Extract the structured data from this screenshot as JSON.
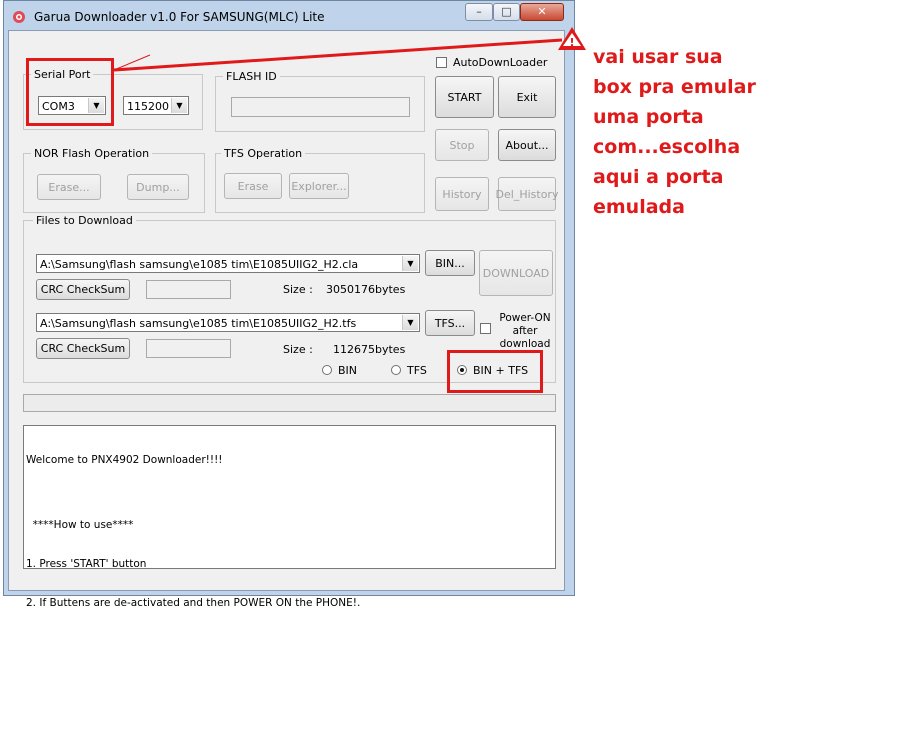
{
  "window": {
    "title": "Garua Downloader v1.0 For SAMSUNG(MLC) Lite",
    "controls": {
      "minimize": "–",
      "maximize": "□",
      "close": "✕"
    }
  },
  "serial_port": {
    "label": "Serial Port",
    "port": "COM3",
    "baud": "115200"
  },
  "flash_id": {
    "label": "FLASH ID",
    "value": ""
  },
  "auto_download": {
    "label": "AutoDownLoader",
    "checked": false
  },
  "buttons": {
    "start": "START",
    "exit": "Exit",
    "stop": "Stop",
    "about": "About...",
    "history": "History",
    "del_history": "Del_History"
  },
  "nor": {
    "label": "NOR Flash Operation",
    "erase": "Erase...",
    "dump": "Dump..."
  },
  "tfs": {
    "label": "TFS Operation",
    "erase": "Erase",
    "explorer": "Explorer..."
  },
  "files": {
    "label": "Files to Download",
    "bin_path": "A:\\Samsung\\flash samsung\\e1085 tim\\E1085UIIG2_H2.cla",
    "bin_button": "BIN...",
    "download": "DOWNLOAD",
    "crc1": "CRC CheckSum",
    "size_label": "Size :",
    "bin_size": "3050176",
    "bytes": "bytes",
    "tfs_path": "A:\\Samsung\\flash samsung\\e1085 tim\\E1085UIIG2_H2.tfs",
    "tfs_button": "TFS...",
    "power_on": [
      "Power-ON",
      "after",
      "download"
    ],
    "crc2": "CRC CheckSum",
    "tfs_size": "112675",
    "radio_bin": "BIN",
    "radio_tfs": "TFS",
    "radio_both": "BIN + TFS",
    "selected": "BIN + TFS"
  },
  "log": [
    "Welcome to PNX4902 Downloader!!!!",
    "",
    "  ****How to use****",
    "1. Press 'START' button",
    "2. If Buttens are de-activated and then POWER ON the PHONE!."
  ],
  "annotation": {
    "lines": [
      "vai usar sua",
      "box pra emular",
      "uma porta",
      "com...escolha",
      "aqui a porta",
      "emulada"
    ],
    "color": "#e01a1a",
    "warning_icon": "!"
  }
}
